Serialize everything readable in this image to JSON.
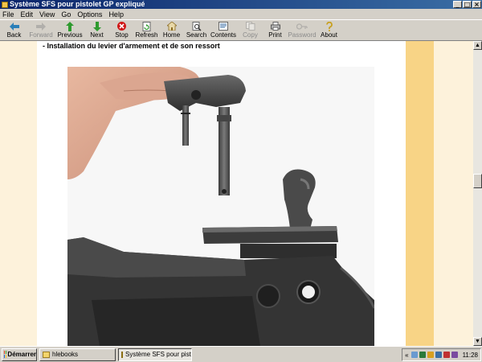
{
  "window": {
    "title": "Système SFS pour pistolet GP expliqué",
    "controls": {
      "minimize": "_",
      "maximize": "□",
      "close": "×"
    }
  },
  "menubar": {
    "items": [
      "File",
      "Edit",
      "View",
      "Go",
      "Options",
      "Help"
    ]
  },
  "toolbar": {
    "buttons": [
      {
        "label": "Back",
        "icon": "arrow-left-icon",
        "color": "#2a7fb8",
        "enabled": true
      },
      {
        "label": "Forward",
        "icon": "arrow-right-icon",
        "color": "#888888",
        "enabled": false
      },
      {
        "label": "Previous",
        "icon": "arrow-up-icon",
        "color": "#2e9a2e",
        "enabled": true
      },
      {
        "label": "Next",
        "icon": "arrow-down-icon",
        "color": "#2e9a2e",
        "enabled": true
      },
      {
        "label": "Stop",
        "icon": "stop-icon",
        "color": "#d01818",
        "enabled": true
      },
      {
        "label": "Refresh",
        "icon": "refresh-icon",
        "color": "#2e9a2e",
        "enabled": true
      },
      {
        "label": "Home",
        "icon": "home-icon",
        "color": "#c89a3a",
        "enabled": true
      },
      {
        "label": "Search",
        "icon": "search-icon",
        "color": "#555555",
        "enabled": true
      },
      {
        "label": "Contents",
        "icon": "contents-icon",
        "color": "#3a6ea5",
        "enabled": true
      },
      {
        "label": "Copy",
        "icon": "copy-icon",
        "color": "#888888",
        "enabled": false
      },
      {
        "label": "Print",
        "icon": "print-icon",
        "color": "#555555",
        "enabled": true
      },
      {
        "label": "Password",
        "icon": "key-icon",
        "color": "#888888",
        "enabled": false
      },
      {
        "label": "About",
        "icon": "about-icon",
        "color": "#c8a020",
        "enabled": true
      }
    ]
  },
  "page": {
    "heading": "- Installation du levier d'armement et de son ressort",
    "colors": {
      "background": "#fdf2db",
      "main": "#ffffff",
      "stripe": "#f8d486"
    }
  },
  "taskbar": {
    "start_label": "Démarrer",
    "tasks": [
      {
        "label": "hlebooks",
        "active": false
      },
      {
        "label": "Système SFS pour pist...",
        "active": true
      }
    ],
    "tray_chevron": "«",
    "clock": "11:28"
  }
}
